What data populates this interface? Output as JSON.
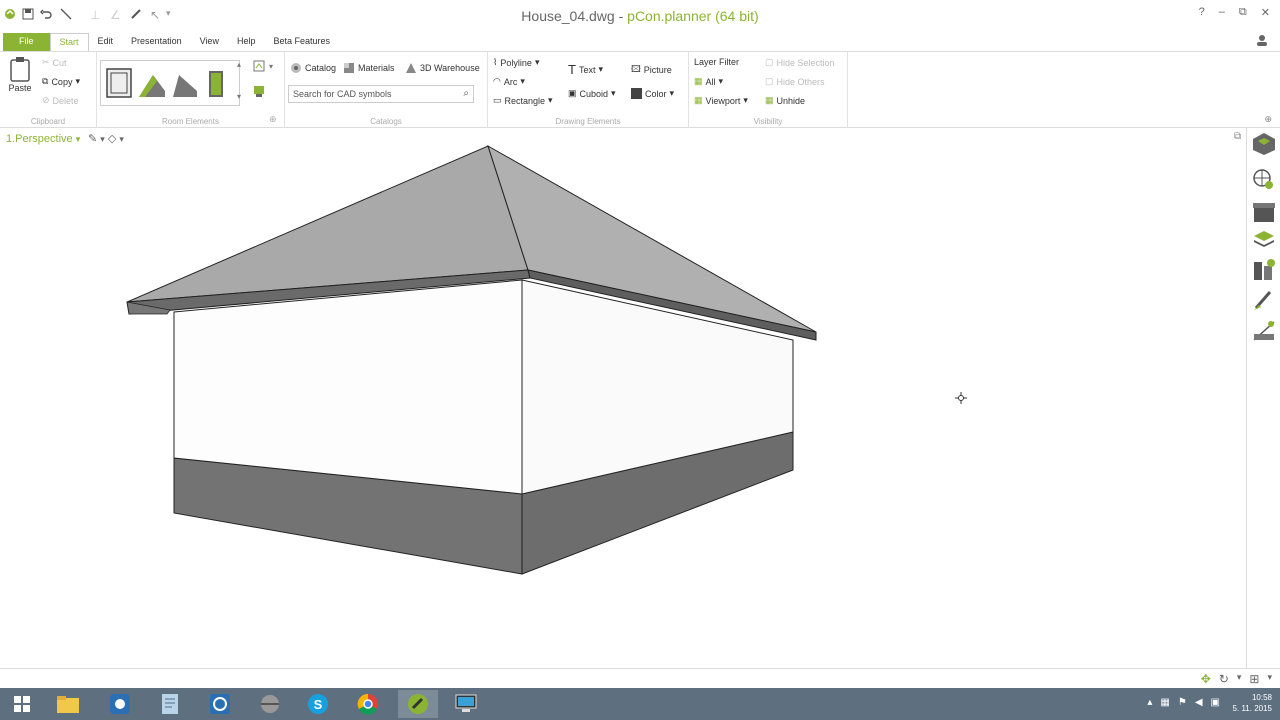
{
  "window": {
    "file_name": "House_04.dwg",
    "separator": " - ",
    "app_name": "pCon.planner (64 bit)",
    "controls": [
      "?",
      "–",
      "⧉",
      "✕"
    ]
  },
  "tabs": [
    "File",
    "Start",
    "Edit",
    "Presentation",
    "View",
    "Help",
    "Beta Features"
  ],
  "ribbon": {
    "clipboard": {
      "label": "Clipboard",
      "paste": "Paste",
      "cut": "Cut",
      "copy": "Copy",
      "delete": "Delete"
    },
    "room_elements": {
      "label": "Room Elements"
    },
    "catalogs": {
      "label": "Catalogs",
      "catalog": "Catalog",
      "materials": "Materials",
      "warehouse": "3D Warehouse",
      "search_placeholder": "Search for CAD symbols"
    },
    "drawing": {
      "label": "Drawing Elements",
      "polyline": "Polyline",
      "arc": "Arc",
      "rectangle": "Rectangle",
      "text": "Text",
      "cuboid": "Cuboid",
      "picture": "Picture",
      "color": "Color"
    },
    "visibility": {
      "label": "Visibility",
      "layer_filter": "Layer Filter",
      "all": "All",
      "viewport": "Viewport",
      "unhide": "Unhide",
      "hide_selection": "Hide Selection",
      "hide_others": "Hide Others"
    }
  },
  "viewport": {
    "label": "1.Perspective",
    "dropdown": "▾"
  },
  "taskbar": {
    "time": "10:58",
    "date": "5. 11. 2015"
  },
  "colors": {
    "accent": "#8cb434",
    "taskbar": "#5e6f80",
    "roof": "#a7a7a7",
    "base": "#737373"
  }
}
